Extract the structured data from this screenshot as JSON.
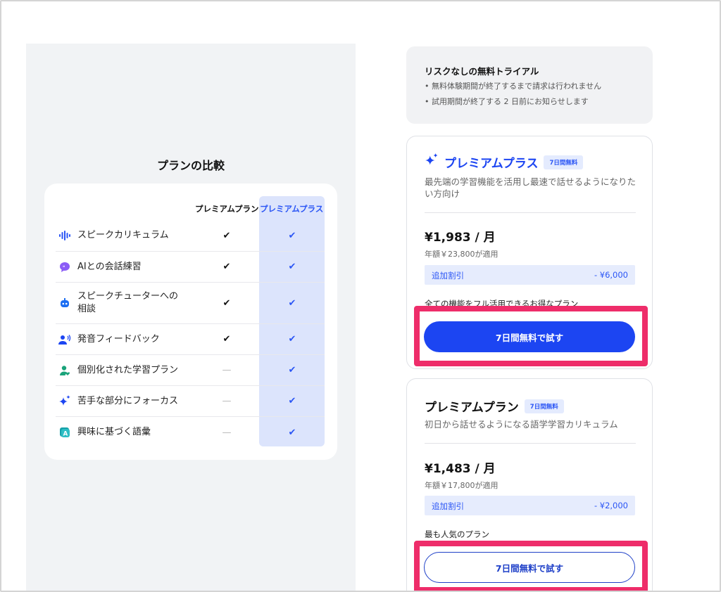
{
  "comparison": {
    "title": "プランの比較",
    "col_premium": "プレミアムプラン",
    "col_plus": "プレミアムプラス",
    "rows": [
      {
        "label": "スピークカリキュラム",
        "icon": "waveform-icon",
        "premium": "✔",
        "plus": "✔"
      },
      {
        "label": "AIとの会話練習",
        "icon": "chat-bubble-icon",
        "premium": "✔",
        "plus": "✔"
      },
      {
        "label": "スピークチューターへの相談",
        "icon": "robot-icon",
        "premium": "✔",
        "plus": "✔"
      },
      {
        "label": "発音フィードバック",
        "icon": "speaking-person-icon",
        "premium": "✔",
        "plus": "✔"
      },
      {
        "label": "個別化された学習プラン",
        "icon": "person-heart-icon",
        "premium": "—",
        "plus": "✔"
      },
      {
        "label": "苦手な部分にフォーカス",
        "icon": "sparkle-icon",
        "premium": "—",
        "plus": "✔"
      },
      {
        "label": "興味に基づく語彙",
        "icon": "letter-a-icon",
        "premium": "—",
        "plus": "✔"
      }
    ]
  },
  "trial": {
    "title": "リスクなしの無料トライアル",
    "bullets": [
      "• 無料体験期間が終了するまで請求は行われません",
      "• 試用期間が終了する 2 日前にお知らせします"
    ]
  },
  "plans": [
    {
      "name": "プレミアムプラス",
      "badge": "7日間無料",
      "icon": "sparkle-icon",
      "description": "最先端の学習機能を活用し最速で話せるようになりたい方向け",
      "price": "¥1,983 / 月",
      "annual": "年額￥23,800が適用",
      "discount_label": "追加割引",
      "discount_value": "- ¥6,000",
      "tagline": "全ての機能をフル活用できるお得なプラン",
      "cta": "7日間無料で試す"
    },
    {
      "name": "プレミアムプラン",
      "badge": "7日間無料",
      "description": "初日から話せるようになる語学学習カリキュラム",
      "price": "¥1,483 / 月",
      "annual": "年額￥17,800が適用",
      "discount_label": "追加割引",
      "discount_value": "- ¥2,000",
      "tagline": "最も人気のプラン",
      "cta": "7日間無料で試す"
    }
  ],
  "colors": {
    "accent": "#1c45f2",
    "highlight": "#ee2d6a",
    "plus_column": "#dce4fc"
  }
}
